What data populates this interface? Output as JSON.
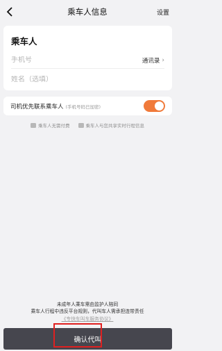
{
  "header": {
    "title": "乘车人信息",
    "settings_label": "设置"
  },
  "passenger_card": {
    "title": "乘车人",
    "phone_placeholder": "手机号",
    "contacts_label": "通讯录",
    "name_placeholder": "姓名（选填）"
  },
  "contact_option": {
    "label": "司机优先联系乘车人",
    "hint": "(手机号码已加密)",
    "toggle_on": true
  },
  "info": {
    "no_payment": "乘车人无需付费",
    "share_trip": "乘车人与您共享实时行程信息"
  },
  "notice": {
    "line1": "未成年人乘车需由监护人陪同",
    "line2": "乘车人行程中违反平台规则，代叫车人需承担连带责任",
    "agreement_link": "《专快车叫车服务协议》"
  },
  "confirm_button": {
    "label": "确认代叫"
  },
  "colors": {
    "toggle": "#f07a3a",
    "button_bg": "#46464e",
    "highlight": "#e02020"
  }
}
